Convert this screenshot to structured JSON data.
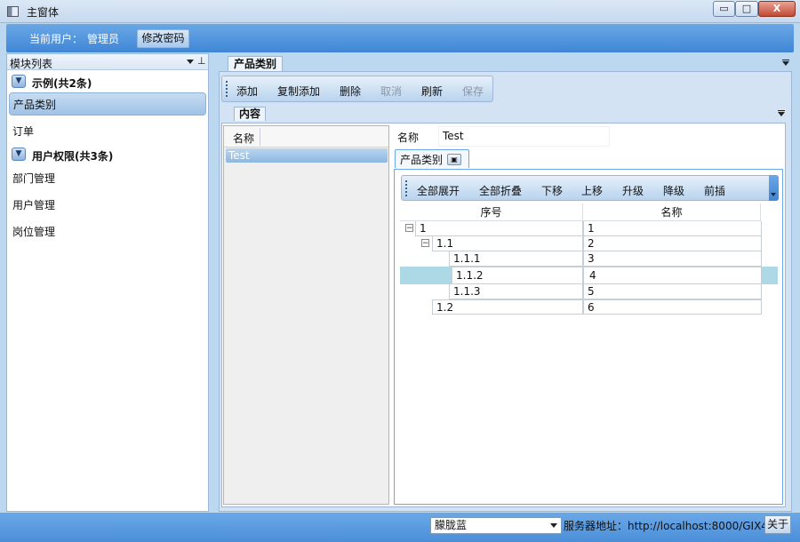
{
  "window": {
    "title": "主窗体"
  },
  "window_buttons": {
    "minimize": "▭",
    "maximize": "□",
    "close": "X"
  },
  "userbar": {
    "current_user_label": "当前用户：",
    "current_user": "管理员",
    "change_password": "修改密码"
  },
  "left_panel": {
    "title": "模块列表",
    "pin": "⊥",
    "groups": [
      {
        "label": "示例(共2条)",
        "items": [
          "产品类别",
          "订单"
        ]
      },
      {
        "label": "用户权限(共3条)",
        "items": [
          "部门管理",
          "用户管理",
          "岗位管理"
        ]
      }
    ]
  },
  "document": {
    "tab": "产品类别",
    "content_tab": "内容"
  },
  "toolbar1": {
    "buttons": [
      "添加",
      "复制添加",
      "删除",
      "取消",
      "刷新",
      "保存"
    ]
  },
  "list": {
    "header": "名称",
    "rows": [
      "Test"
    ]
  },
  "detail": {
    "name_label": "名称",
    "name_value": "Test",
    "inner_tab": "产品类别",
    "toolbar": [
      "全部展开",
      "全部折叠",
      "下移",
      "上移",
      "升级",
      "降级",
      "前插"
    ],
    "grid": {
      "columns": [
        "序号",
        "名称"
      ],
      "rows": [
        {
          "seq": "1",
          "name": "1",
          "toggle": "−"
        },
        {
          "seq": "1.1",
          "name": "2",
          "toggle": "−"
        },
        {
          "seq": "1.1.1",
          "name": "3"
        },
        {
          "seq": "1.1.2",
          "name": "4"
        },
        {
          "seq": "1.1.3",
          "name": "5"
        },
        {
          "seq": "1.2",
          "name": "6"
        }
      ]
    }
  },
  "statusbar": {
    "theme": "朦胧蓝",
    "server": "服务器地址：http://localhost:8000/GIX4",
    "about": "关于"
  },
  "colors": {
    "accent": "#3f86d6",
    "selection": "#add8e6"
  }
}
